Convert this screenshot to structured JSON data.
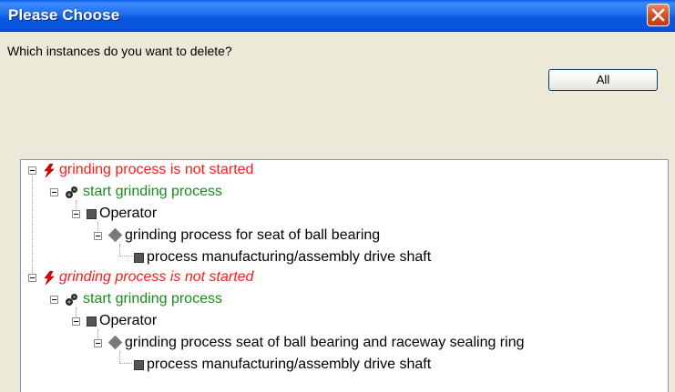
{
  "dialog": {
    "title": "Please Choose",
    "prompt": "Which instances do you want to delete?",
    "all_button": "All"
  },
  "tree": [
    {
      "label": "grinding process is not started",
      "level": 0,
      "color": "#ff1a1a",
      "italic": false,
      "icon": "red-lightning-icon"
    },
    {
      "label": "start grinding process",
      "level": 1,
      "color": "#1a8a1a",
      "italic": false,
      "icon": "gears-icon"
    },
    {
      "label": "Operator",
      "level": 2,
      "color": "#000000",
      "italic": false,
      "icon": "square-icon"
    },
    {
      "label": "grinding process for seat of ball bearing",
      "level": 3,
      "color": "#000000",
      "italic": false,
      "icon": "diamond-icon"
    },
    {
      "label": "process manufacturing/assembly drive shaft",
      "level": 4,
      "color": "#000000",
      "italic": false,
      "icon": "square-icon"
    },
    {
      "label": "grinding process is not started",
      "level": 0,
      "color": "#ff1a1a",
      "italic": true,
      "icon": "red-lightning-icon"
    },
    {
      "label": "start grinding process",
      "level": 1,
      "color": "#1a8a1a",
      "italic": false,
      "icon": "gears-icon"
    },
    {
      "label": "Operator",
      "level": 2,
      "color": "#000000",
      "italic": false,
      "icon": "square-icon"
    },
    {
      "label": "grinding process seat of ball bearing and raceway sealing ring",
      "level": 3,
      "color": "#000000",
      "italic": false,
      "icon": "diamond-icon"
    },
    {
      "label": "process manufacturing/assembly drive shaft",
      "level": 4,
      "color": "#000000",
      "italic": false,
      "icon": "square-icon"
    }
  ]
}
